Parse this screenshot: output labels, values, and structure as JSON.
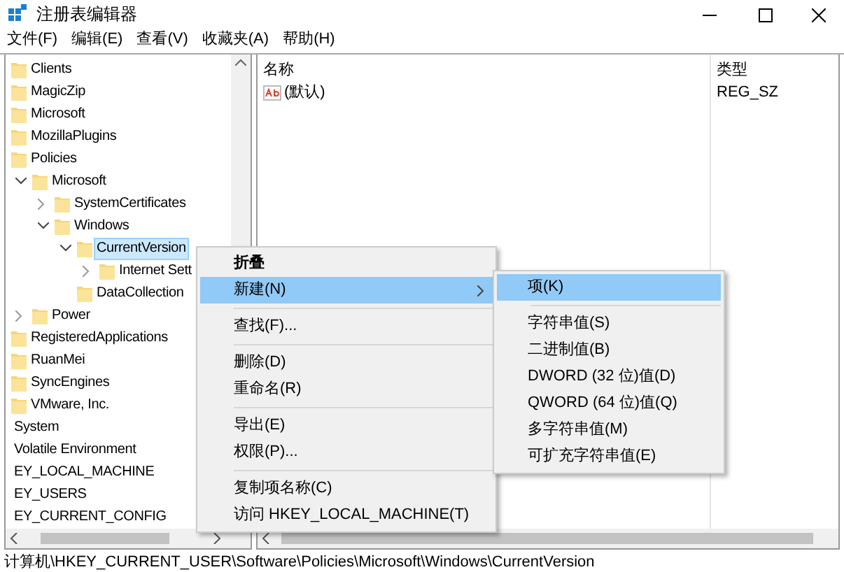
{
  "window": {
    "title": "注册表编辑器"
  },
  "menu_bar": [
    "文件(F)",
    "编辑(E)",
    "查看(V)",
    "收藏夹(A)",
    "帮助(H)"
  ],
  "tree": [
    {
      "label": "Clients",
      "kind": "folder"
    },
    {
      "label": "MagicZip",
      "kind": "folder"
    },
    {
      "label": "Microsoft",
      "kind": "folder"
    },
    {
      "label": "MozillaPlugins",
      "kind": "folder"
    },
    {
      "label": "Policies",
      "kind": "folder",
      "children": [
        {
          "label": "Microsoft",
          "kind": "folder",
          "expanded": true,
          "children": [
            {
              "label": "SystemCertificates",
              "kind": "folder",
              "expanded": false
            },
            {
              "label": "Windows",
              "kind": "folder",
              "expanded": true,
              "children": [
                {
                  "label": "CurrentVersion",
                  "kind": "folder",
                  "selected": true,
                  "expanded": true,
                  "children": [
                    {
                      "label": "Internet Sett",
                      "kind": "folder",
                      "expanded": false
                    }
                  ]
                },
                {
                  "label": "DataCollection",
                  "kind": "folder"
                }
              ]
            }
          ]
        },
        {
          "label": "Power",
          "kind": "folder",
          "expanded": false
        }
      ]
    },
    {
      "label": "RegisteredApplications",
      "kind": "folder"
    },
    {
      "label": "RuanMei",
      "kind": "folder"
    },
    {
      "label": "SyncEngines",
      "kind": "folder"
    },
    {
      "label": "VMware, Inc.",
      "kind": "folder"
    },
    {
      "label": "System",
      "kind": "text"
    },
    {
      "label": "Volatile Environment",
      "kind": "text"
    },
    {
      "label": "EY_LOCAL_MACHINE",
      "kind": "text"
    },
    {
      "label": "EY_USERS",
      "kind": "text"
    },
    {
      "label": "EY_CURRENT_CONFIG",
      "kind": "text"
    }
  ],
  "values_table": {
    "columns": [
      "名称",
      "类型"
    ],
    "rows": [
      {
        "name": "(默认)",
        "type": "REG_SZ"
      }
    ]
  },
  "context_menu": [
    {
      "kind": "item",
      "label": "折叠",
      "bold": true,
      "selected": false
    },
    {
      "kind": "item",
      "label": "新建(N)",
      "selected": true,
      "submenu": true
    },
    {
      "kind": "separator"
    },
    {
      "kind": "item",
      "label": "查找(F)...",
      "selected": false
    },
    {
      "kind": "separator"
    },
    {
      "kind": "item",
      "label": "删除(D)",
      "selected": false
    },
    {
      "kind": "item",
      "label": "重命名(R)",
      "selected": false
    },
    {
      "kind": "separator"
    },
    {
      "kind": "item",
      "label": "导出(E)",
      "selected": false
    },
    {
      "kind": "item",
      "label": "权限(P)...",
      "selected": false
    },
    {
      "kind": "separator"
    },
    {
      "kind": "item",
      "label": "复制项名称(C)",
      "selected": false
    },
    {
      "kind": "item",
      "label": "访问 HKEY_LOCAL_MACHINE(T)",
      "selected": false
    }
  ],
  "submenu": [
    {
      "kind": "item",
      "label": "项(K)",
      "selected": true
    },
    {
      "kind": "separator"
    },
    {
      "kind": "item",
      "label": "字符串值(S)",
      "selected": false
    },
    {
      "kind": "item",
      "label": "二进制值(B)",
      "selected": false
    },
    {
      "kind": "item",
      "label": "DWORD (32 位)值(D)",
      "selected": false
    },
    {
      "kind": "item",
      "label": "QWORD (64 位)值(Q)",
      "selected": false
    },
    {
      "kind": "item",
      "label": "多字符串值(M)",
      "selected": false
    },
    {
      "kind": "item",
      "label": "可扩充字符串值(E)",
      "selected": false
    }
  ],
  "status_bar": "计算机\\HKEY_CURRENT_USER\\Software\\Policies\\Microsoft\\Windows\\CurrentVersion"
}
